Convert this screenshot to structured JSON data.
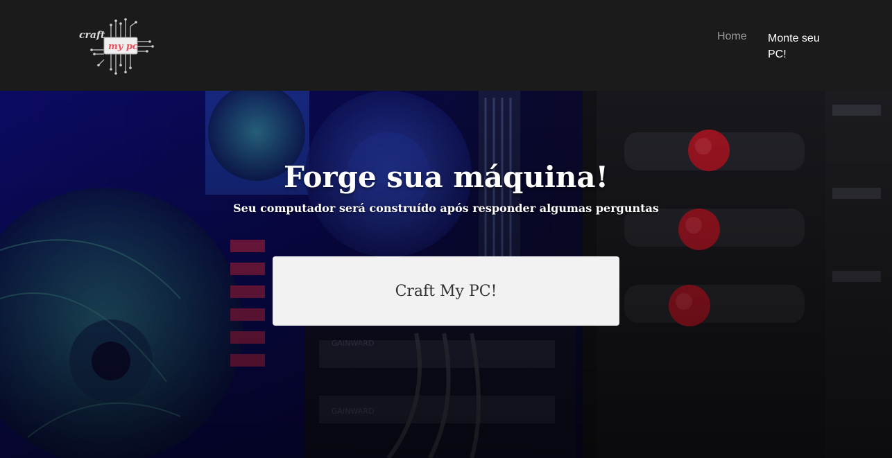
{
  "header": {
    "logo": {
      "line1": "craft",
      "line2": "my pc"
    },
    "nav": [
      {
        "label": "Home"
      },
      {
        "label": "Monte seu PC!"
      }
    ]
  },
  "hero": {
    "title": "Forge sua máquina!",
    "subtitle": "Seu computador será construído após responder algumas perguntas",
    "cta_label": "Craft My PC!"
  },
  "colors": {
    "navbar_bg": "#1b1b1b",
    "nav_inactive": "#9c9c9c",
    "nav_active": "#ffffff",
    "button_bg": "#f2f2f2",
    "logo_accent": "#e8505b"
  }
}
